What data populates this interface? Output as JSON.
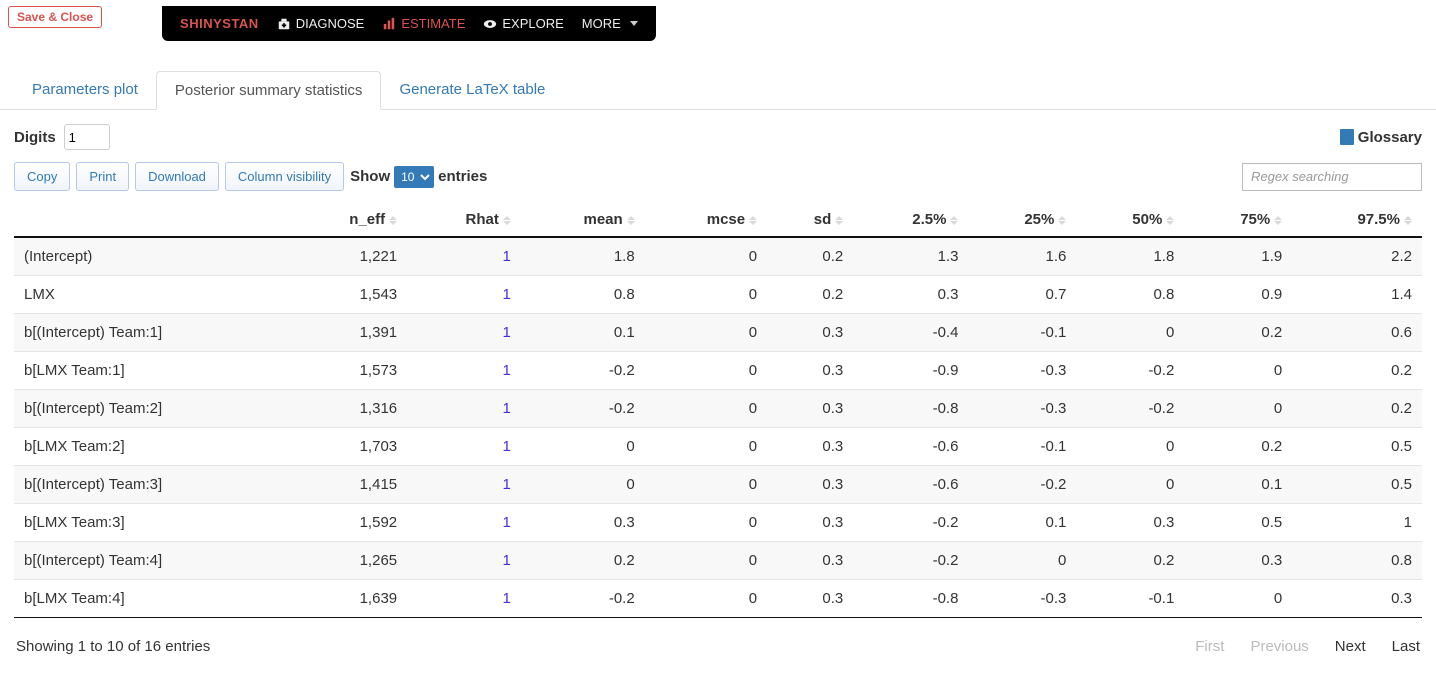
{
  "save_close": "Save & Close",
  "brand": "SHINYSTAN",
  "nav": {
    "diagnose": "DIAGNOSE",
    "estimate": "ESTIMATE",
    "explore": "EXPLORE",
    "more": "MORE"
  },
  "tabs": {
    "params": "Parameters plot",
    "posterior": "Posterior summary statistics",
    "latex": "Generate LaTeX table"
  },
  "digits": {
    "label": "Digits",
    "value": "1"
  },
  "glossary": "Glossary",
  "buttons": {
    "copy": "Copy",
    "print": "Print",
    "download": "Download",
    "colvis": "Column visibility"
  },
  "show": {
    "label": "Show",
    "value": "10",
    "suffix": "entries"
  },
  "search_placeholder": "Regex searching",
  "columns": [
    "",
    "n_eff",
    "Rhat",
    "mean",
    "mcse",
    "sd",
    "2.5%",
    "25%",
    "50%",
    "75%",
    "97.5%"
  ],
  "rows": [
    {
      "param": "(Intercept)",
      "n_eff": "1,221",
      "rhat": "1",
      "mean": "1.8",
      "mcse": "0",
      "sd": "0.2",
      "p2_5": "1.3",
      "p25": "1.6",
      "p50": "1.8",
      "p75": "1.9",
      "p97_5": "2.2"
    },
    {
      "param": "LMX",
      "n_eff": "1,543",
      "rhat": "1",
      "mean": "0.8",
      "mcse": "0",
      "sd": "0.2",
      "p2_5": "0.3",
      "p25": "0.7",
      "p50": "0.8",
      "p75": "0.9",
      "p97_5": "1.4"
    },
    {
      "param": "b[(Intercept) Team:1]",
      "n_eff": "1,391",
      "rhat": "1",
      "mean": "0.1",
      "mcse": "0",
      "sd": "0.3",
      "p2_5": "-0.4",
      "p25": "-0.1",
      "p50": "0",
      "p75": "0.2",
      "p97_5": "0.6"
    },
    {
      "param": "b[LMX Team:1]",
      "n_eff": "1,573",
      "rhat": "1",
      "mean": "-0.2",
      "mcse": "0",
      "sd": "0.3",
      "p2_5": "-0.9",
      "p25": "-0.3",
      "p50": "-0.2",
      "p75": "0",
      "p97_5": "0.2"
    },
    {
      "param": "b[(Intercept) Team:2]",
      "n_eff": "1,316",
      "rhat": "1",
      "mean": "-0.2",
      "mcse": "0",
      "sd": "0.3",
      "p2_5": "-0.8",
      "p25": "-0.3",
      "p50": "-0.2",
      "p75": "0",
      "p97_5": "0.2"
    },
    {
      "param": "b[LMX Team:2]",
      "n_eff": "1,703",
      "rhat": "1",
      "mean": "0",
      "mcse": "0",
      "sd": "0.3",
      "p2_5": "-0.6",
      "p25": "-0.1",
      "p50": "0",
      "p75": "0.2",
      "p97_5": "0.5"
    },
    {
      "param": "b[(Intercept) Team:3]",
      "n_eff": "1,415",
      "rhat": "1",
      "mean": "0",
      "mcse": "0",
      "sd": "0.3",
      "p2_5": "-0.6",
      "p25": "-0.2",
      "p50": "0",
      "p75": "0.1",
      "p97_5": "0.5"
    },
    {
      "param": "b[LMX Team:3]",
      "n_eff": "1,592",
      "rhat": "1",
      "mean": "0.3",
      "mcse": "0",
      "sd": "0.3",
      "p2_5": "-0.2",
      "p25": "0.1",
      "p50": "0.3",
      "p75": "0.5",
      "p97_5": "1"
    },
    {
      "param": "b[(Intercept) Team:4]",
      "n_eff": "1,265",
      "rhat": "1",
      "mean": "0.2",
      "mcse": "0",
      "sd": "0.3",
      "p2_5": "-0.2",
      "p25": "0",
      "p50": "0.2",
      "p75": "0.3",
      "p97_5": "0.8"
    },
    {
      "param": "b[LMX Team:4]",
      "n_eff": "1,639",
      "rhat": "1",
      "mean": "-0.2",
      "mcse": "0",
      "sd": "0.3",
      "p2_5": "-0.8",
      "p25": "-0.3",
      "p50": "-0.1",
      "p75": "0",
      "p97_5": "0.3"
    }
  ],
  "footer_info": "Showing 1 to 10 of 16 entries",
  "pager": {
    "first": "First",
    "prev": "Previous",
    "next": "Next",
    "last": "Last"
  }
}
